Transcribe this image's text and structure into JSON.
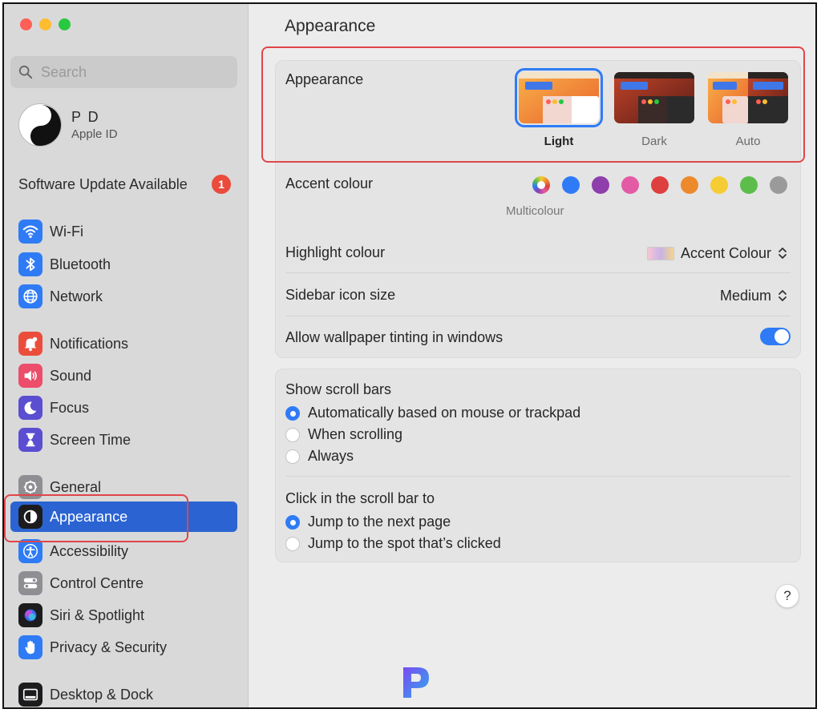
{
  "sidebar": {
    "search_placeholder": "Search",
    "profile": {
      "name": "P D",
      "subtitle": "Apple ID"
    },
    "update": {
      "label": "Software Update Available",
      "count": "1"
    },
    "items": [
      {
        "label": "Wi-Fi",
        "icon": "wifi-icon",
        "color": "#2f7bf6"
      },
      {
        "label": "Bluetooth",
        "icon": "bluetooth-icon",
        "color": "#2f7bf6"
      },
      {
        "label": "Network",
        "icon": "globe-icon",
        "color": "#2f7bf6"
      },
      {
        "label": "Notifications",
        "icon": "bell-icon",
        "color": "#eb4d3d"
      },
      {
        "label": "Sound",
        "icon": "speaker-icon",
        "color": "#eb4d6a"
      },
      {
        "label": "Focus",
        "icon": "moon-icon",
        "color": "#5b4ed1"
      },
      {
        "label": "Screen Time",
        "icon": "hourglass-icon",
        "color": "#5b4ed1"
      },
      {
        "label": "General",
        "icon": "gear-icon",
        "color": "#8e8e93"
      },
      {
        "label": "Appearance",
        "icon": "appearance-icon",
        "color": "#1c1c1e",
        "selected": true
      },
      {
        "label": "Accessibility",
        "icon": "accessibility-icon",
        "color": "#2f7bf6"
      },
      {
        "label": "Control Centre",
        "icon": "toggles-icon",
        "color": "#8e8e93"
      },
      {
        "label": "Siri & Spotlight",
        "icon": "siri-icon",
        "color": "#1c1c1e"
      },
      {
        "label": "Privacy & Security",
        "icon": "hand-icon",
        "color": "#2f7bf6"
      },
      {
        "label": "Desktop & Dock",
        "icon": "dock-icon",
        "color": "#1c1c1e"
      }
    ]
  },
  "main": {
    "title": "Appearance",
    "appearance": {
      "label": "Appearance",
      "options": [
        {
          "label": "Light",
          "selected": true
        },
        {
          "label": "Dark",
          "selected": false
        },
        {
          "label": "Auto",
          "selected": false
        }
      ]
    },
    "accent": {
      "label": "Accent colour",
      "selected_caption": "Multicolour",
      "colors": [
        "multicolour",
        "#2f7bf6",
        "#8e3fab",
        "#e35ba4",
        "#de3f3f",
        "#ed8a2c",
        "#f5cc33",
        "#5cbd4b",
        "#9a9a9a"
      ]
    },
    "highlight": {
      "label": "Highlight colour",
      "value": "Accent Colour"
    },
    "sidebar_icon_size": {
      "label": "Sidebar icon size",
      "value": "Medium"
    },
    "wallpaper_tinting": {
      "label": "Allow wallpaper tinting in windows",
      "enabled": true
    },
    "scroll_bars": {
      "label": "Show scroll bars",
      "options": [
        {
          "label": "Automatically based on mouse or trackpad",
          "selected": true
        },
        {
          "label": "When scrolling",
          "selected": false
        },
        {
          "label": "Always",
          "selected": false
        }
      ]
    },
    "click_scroll": {
      "label": "Click in the scroll bar to",
      "options": [
        {
          "label": "Jump to the next page",
          "selected": true
        },
        {
          "label": "Jump to the spot that’s clicked",
          "selected": false
        }
      ]
    },
    "help_label": "?"
  },
  "colors": {
    "accent": "#2f7bf6",
    "selection": "#2b64d2",
    "annotation": "#e0464a"
  }
}
